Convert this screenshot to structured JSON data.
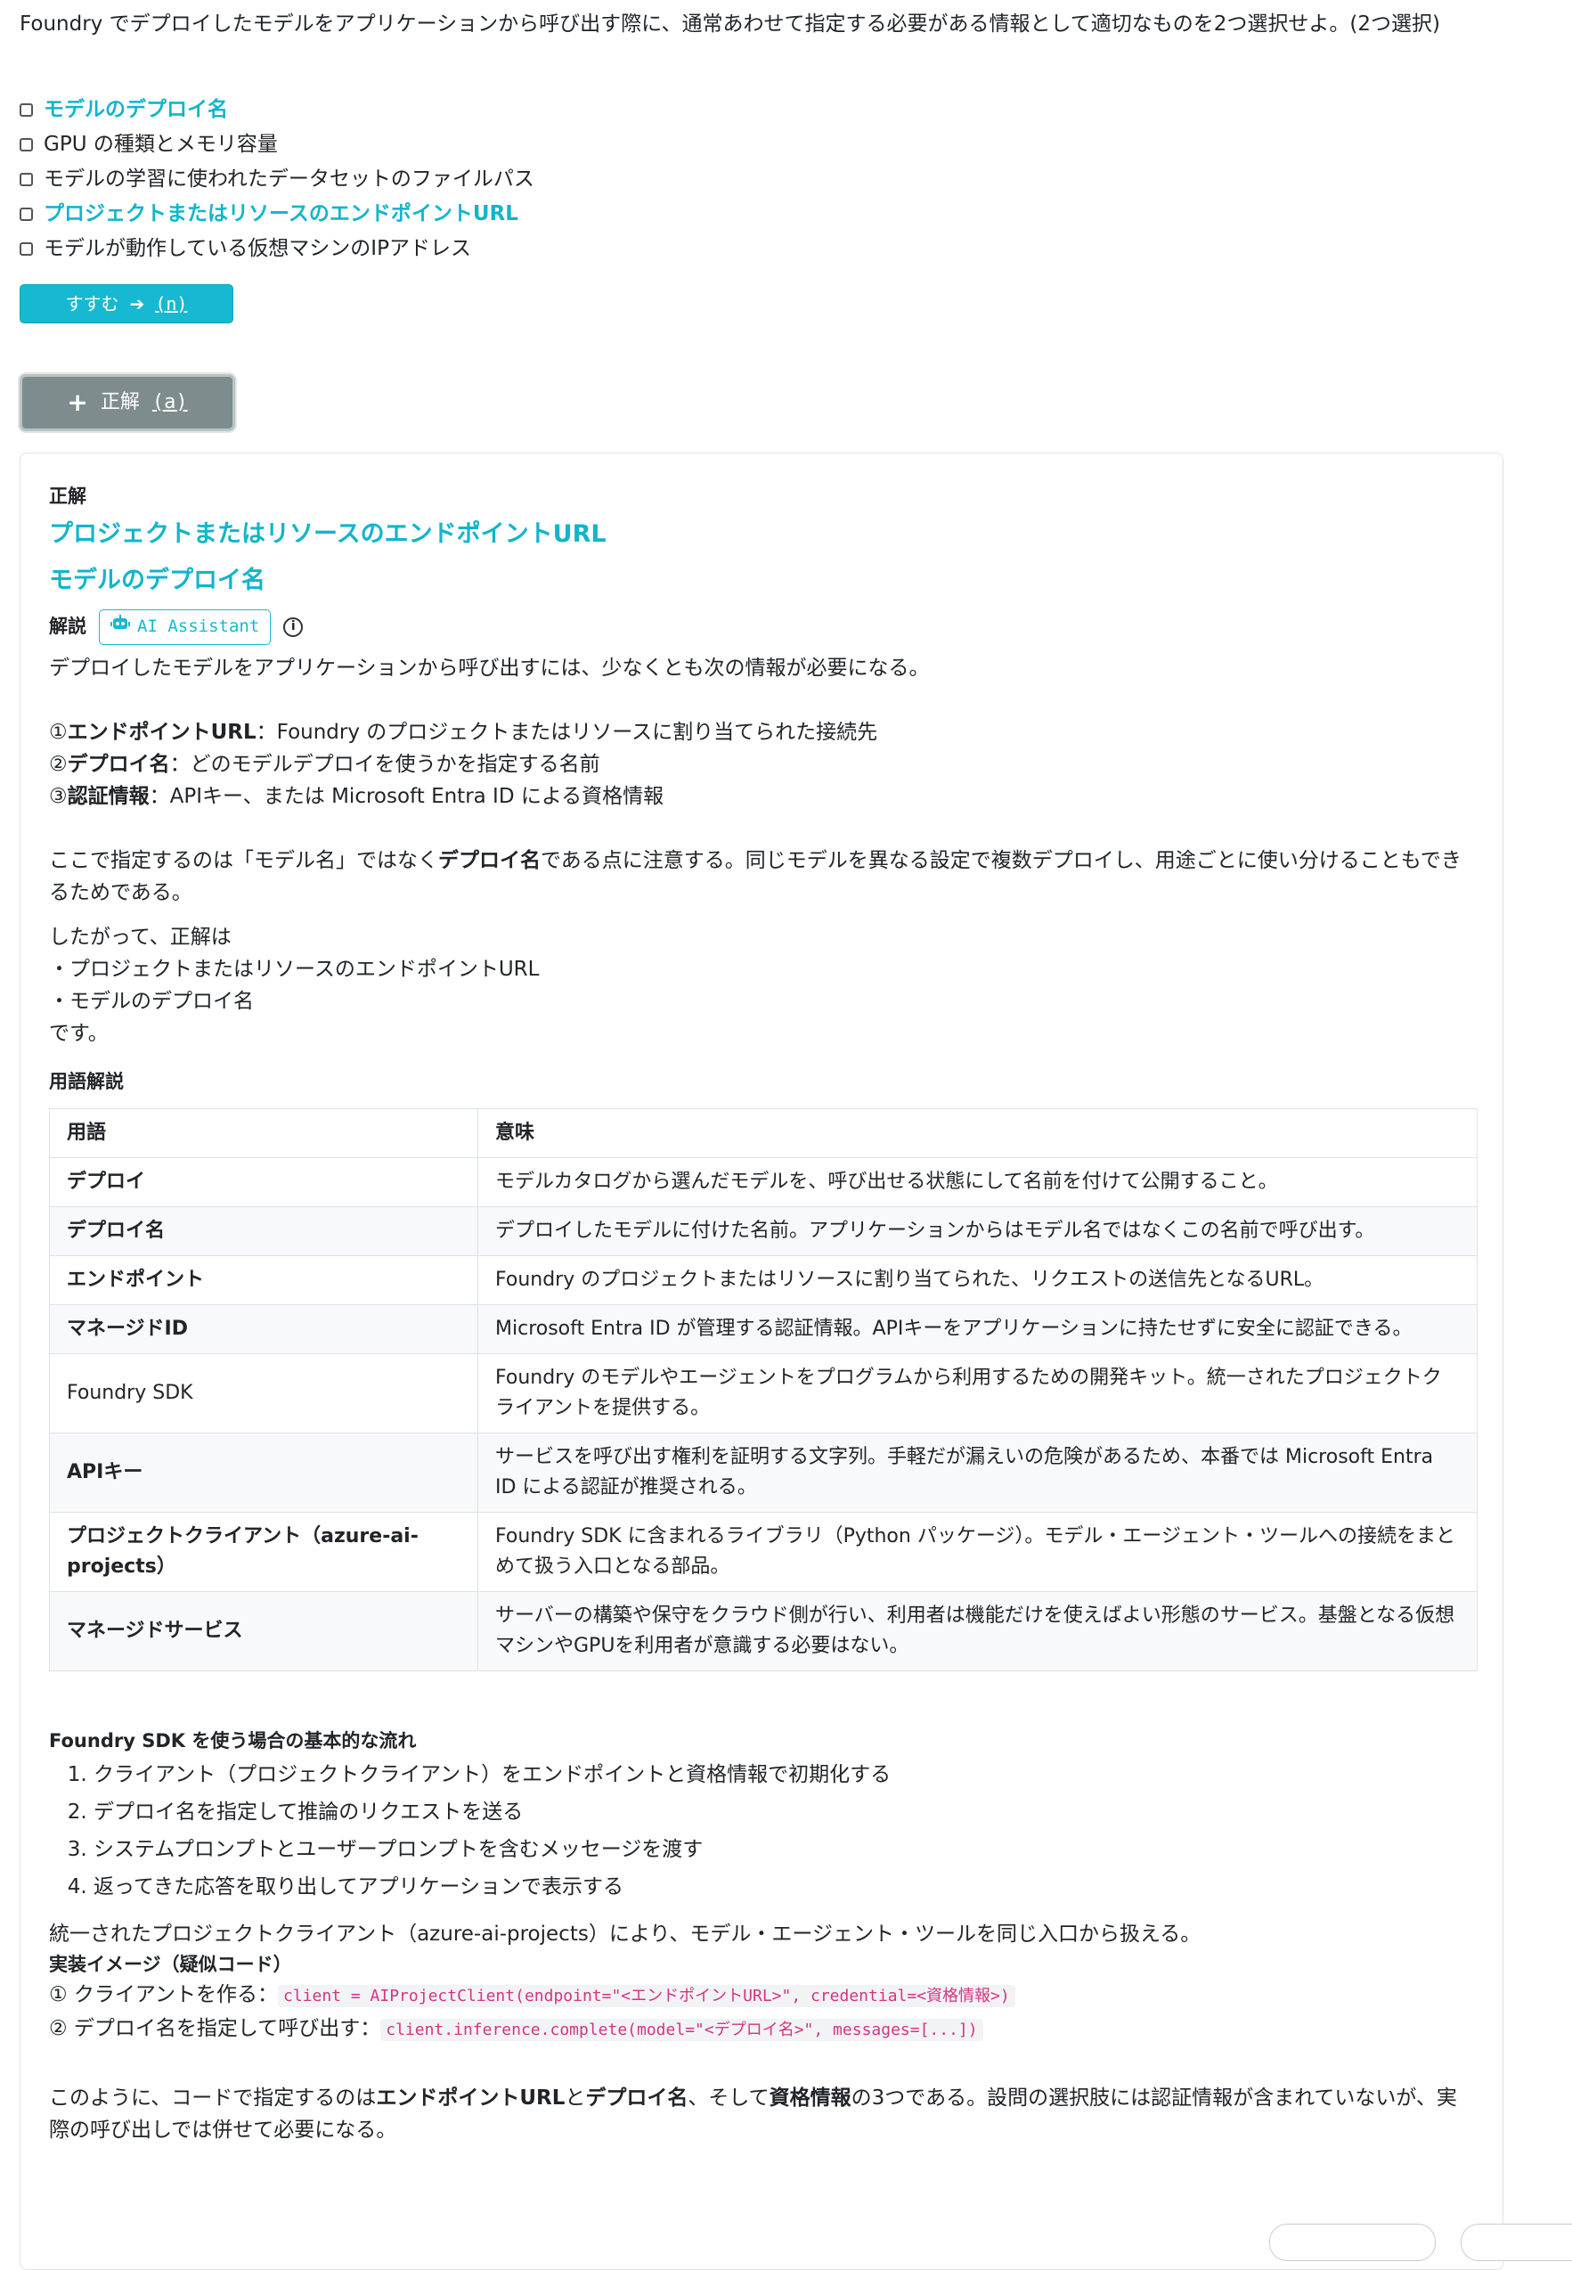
{
  "question": "Foundry でデプロイしたモデルをアプリケーションから呼び出す際に、通常あわせて指定する必要がある情報として適切なものを2つ選択せよ。(2つ選択)",
  "choices": [
    {
      "label": "モデルのデプロイ名",
      "highlight": true
    },
    {
      "label": "GPU の種類とメモリ容量",
      "highlight": false
    },
    {
      "label": "モデルの学習に使われたデータセットのファイルパス",
      "highlight": false
    },
    {
      "label": "プロジェクトまたはリソースのエンドポイントURL",
      "highlight": true
    },
    {
      "label": "モデルが動作している仮想マシンのIPアドレス",
      "highlight": false
    }
  ],
  "next_button": {
    "label": "すすむ",
    "icon": "arrow-right-icon",
    "key": "(n)"
  },
  "answer_button": {
    "label": "正解",
    "icon": "plus-icon",
    "key": "(a)"
  },
  "answer": {
    "heading": "正解",
    "items": [
      "プロジェクトまたはリソースのエンドポイントURL",
      "モデルのデプロイ名"
    ]
  },
  "explanation": {
    "heading": "解説",
    "ai_label": "AI Assistant",
    "intro": "デプロイしたモデルをアプリケーションから呼び出すには、少なくとも次の情報が必要になる。",
    "requirements": [
      {
        "num": "①",
        "term": "エンドポイントURL",
        "text": "：Foundry のプロジェクトまたはリソースに割り当てられた接続先"
      },
      {
        "num": "②",
        "term": "デプロイ名",
        "text": "：どのモデルデプロイを使うかを指定する名前"
      },
      {
        "num": "③",
        "term": "認証情報",
        "text": "：APIキー、または Microsoft Entra ID による資格情報"
      }
    ],
    "note_pre": "ここで指定するのは「モデル名」ではなく",
    "note_bold": "デプロイ名",
    "note_post": "である点に注意する。同じモデルを異なる設定で複数デプロイし、用途ごとに使い分けることもできるためである。",
    "conclusion": [
      "したがって、正解は",
      "・プロジェクトまたはリソースのエンドポイントURL",
      "・モデルのデプロイ名",
      "です。"
    ]
  },
  "glossary": {
    "heading": "用語解説",
    "columns": [
      "用語",
      "意味"
    ],
    "rows": [
      {
        "term": "デプロイ",
        "meaning": "モデルカタログから選んだモデルを、呼び出せる状態にして名前を付けて公開すること。"
      },
      {
        "term": "デプロイ名",
        "meaning": "デプロイしたモデルに付けた名前。アプリケーションからはモデル名ではなくこの名前で呼び出す。"
      },
      {
        "term": "エンドポイント",
        "meaning": "Foundry のプロジェクトまたはリソースに割り当てられた、リクエストの送信先となるURL。"
      },
      {
        "term": "マネージドID",
        "meaning": "Microsoft Entra ID が管理する認証情報。APIキーをアプリケーションに持たせずに安全に認証できる。"
      },
      {
        "term": "Foundry SDK",
        "meaning": "Foundry のモデルやエージェントをプログラムから利用するための開発キット。統一されたプロジェクトクライアントを提供する。"
      },
      {
        "term": "APIキー",
        "meaning": "サービスを呼び出す権利を証明する文字列。手軽だが漏えいの危険があるため、本番では Microsoft Entra ID による認証が推奨される。"
      },
      {
        "term": "プロジェクトクライアント（azure-ai-projects）",
        "meaning": "Foundry SDK に含まれるライブラリ（Python パッケージ）。モデル・エージェント・ツールへの接続をまとめて扱う入口となる部品。"
      },
      {
        "term": "マネージドサービス",
        "meaning": "サーバーの構築や保守をクラウド側が行い、利用者は機能だけを使えばよい形態のサービス。基盤となる仮想マシンやGPUを利用者が意識する必要はない。"
      }
    ]
  },
  "flow": {
    "heading": "Foundry SDK を使う場合の基本的な流れ",
    "steps": [
      "クライアント（プロジェクトクライアント）をエンドポイントと資格情報で初期化する",
      "デプロイ名を指定して推論のリクエストを送る",
      "システムプロンプトとユーザープロンプトを含むメッセージを渡す",
      "返ってきた応答を取り出してアプリケーションで表示する"
    ],
    "summary": "統一されたプロジェクトクライアント（azure-ai-projects）により、モデル・エージェント・ツールを同じ入口から扱える。"
  },
  "implementation": {
    "heading": "実装イメージ（疑似コード）",
    "lines": [
      {
        "label": "① クライアントを作る：",
        "code": "client = AIProjectClient(endpoint=\"<エンドポイントURL>\", credential=<資格情報>)"
      },
      {
        "label": "② デプロイ名を指定して呼び出す：",
        "code": "client.inference.complete(model=\"<デプロイ名>\", messages=[...])"
      }
    ]
  },
  "closing": {
    "p1": "このように、コードで指定するのは",
    "b1": "エンドポイントURL",
    "p2": "と",
    "b2": "デプロイ名",
    "p3": "、そして",
    "b3": "資格情報",
    "p4": "の3つである。設問の選択肢には認証情報が含まれていないが、実際の呼び出しでは併せて必要になる。"
  }
}
